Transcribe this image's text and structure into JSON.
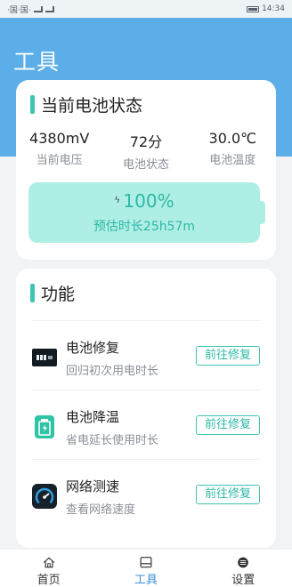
{
  "status_bar": {
    "left": "·国·国·",
    "time": "14:34"
  },
  "page": {
    "title": "工具"
  },
  "battery_card": {
    "title": "当前电池状态",
    "stats": [
      {
        "value": "4380mV",
        "label": "当前电压"
      },
      {
        "value": "72分",
        "label": "电池状态"
      },
      {
        "value": "30.0℃",
        "label": "电池温度"
      }
    ],
    "percent": "100%",
    "level": 1.0,
    "estimate": "预估时长25h57m"
  },
  "function_card": {
    "title": "功能",
    "items": [
      {
        "name": "电池修复",
        "desc": "回归初次用电时长",
        "button": "前往修复",
        "icon": "battery-repair-icon"
      },
      {
        "name": "电池降温",
        "desc": "省电延长使用时长",
        "button": "前往修复",
        "icon": "battery-cool-icon"
      },
      {
        "name": "网络测速",
        "desc": "查看网络速度",
        "button": "前往修复",
        "icon": "speedometer-icon"
      }
    ]
  },
  "tabbar": {
    "tabs": [
      {
        "label": "首页",
        "icon": "home-icon"
      },
      {
        "label": "工具",
        "icon": "tools-icon",
        "active": true
      },
      {
        "label": "设置",
        "icon": "settings-icon"
      }
    ]
  },
  "colors": {
    "header": "#5baee7",
    "accent": "#3ec4b4",
    "battery_fill": "#aeeee5"
  }
}
